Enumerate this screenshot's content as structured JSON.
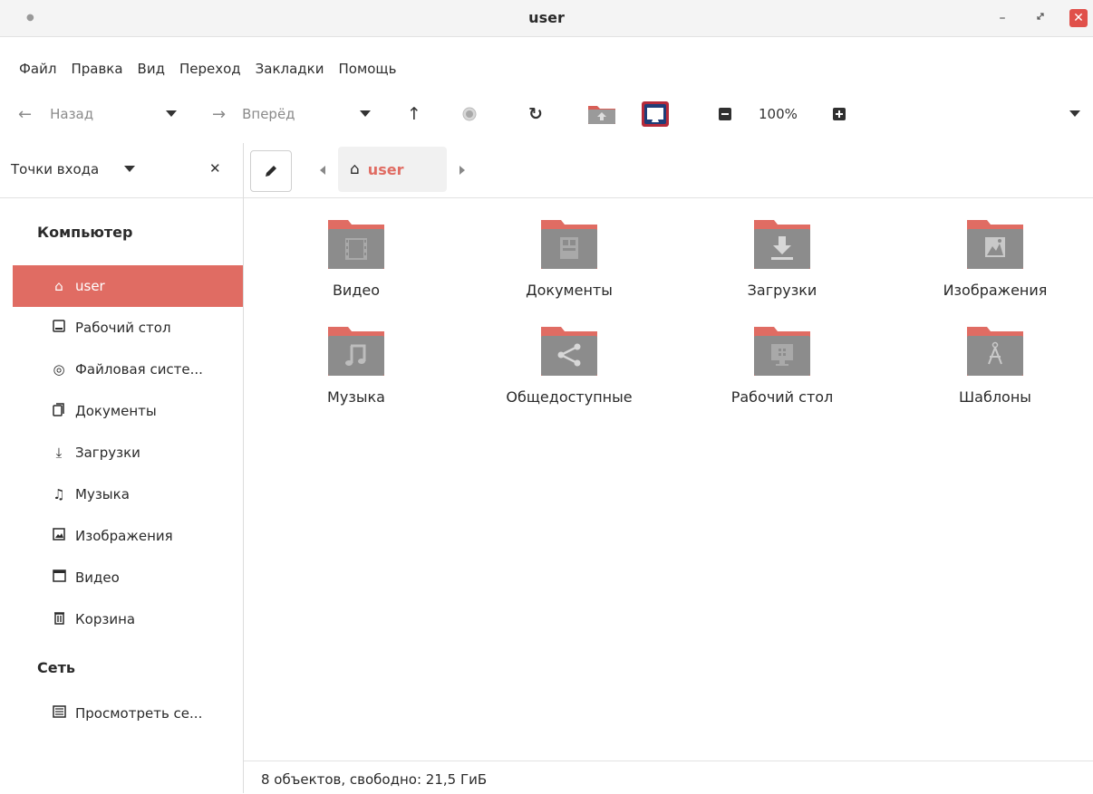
{
  "window": {
    "title": "user"
  },
  "menu": {
    "items": [
      "Файл",
      "Правка",
      "Вид",
      "Переход",
      "Закладки",
      "Помощь"
    ]
  },
  "toolbar": {
    "back_label": "Назад",
    "forward_label": "Вперёд",
    "zoom": "100%"
  },
  "sidebar": {
    "header_label": "Точки входа",
    "computer_title": "Компьютер",
    "network_title": "Сеть",
    "items": [
      {
        "label": "user",
        "icon": "home-icon"
      },
      {
        "label": "Рабочий стол",
        "icon": "desktop-icon"
      },
      {
        "label": "Файловая систе...",
        "icon": "disk-icon"
      },
      {
        "label": "Документы",
        "icon": "documents-icon"
      },
      {
        "label": "Загрузки",
        "icon": "download-icon"
      },
      {
        "label": "Музыка",
        "icon": "music-icon"
      },
      {
        "label": "Изображения",
        "icon": "image-icon"
      },
      {
        "label": "Видео",
        "icon": "video-icon"
      },
      {
        "label": "Корзина",
        "icon": "trash-icon"
      }
    ],
    "network_items": [
      {
        "label": "Просмотреть се...",
        "icon": "network-icon"
      }
    ]
  },
  "pathbar": {
    "crumb": "user"
  },
  "files": [
    {
      "name": "Видео",
      "icon": "video-folder-icon"
    },
    {
      "name": "Документы",
      "icon": "documents-folder-icon"
    },
    {
      "name": "Загрузки",
      "icon": "downloads-folder-icon"
    },
    {
      "name": "Изображения",
      "icon": "pictures-folder-icon"
    },
    {
      "name": "Музыка",
      "icon": "music-folder-icon"
    },
    {
      "name": "Общедоступные",
      "icon": "public-folder-icon"
    },
    {
      "name": "Рабочий стол",
      "icon": "desktop-folder-icon"
    },
    {
      "name": "Шаблоны",
      "icon": "templates-folder-icon"
    }
  ],
  "status": {
    "text": "8 объектов, свободно: 21,5 ГиБ"
  },
  "colors": {
    "accent": "#e06c63",
    "folder_body": "#8c8c8c",
    "close_button": "#e0504a"
  }
}
